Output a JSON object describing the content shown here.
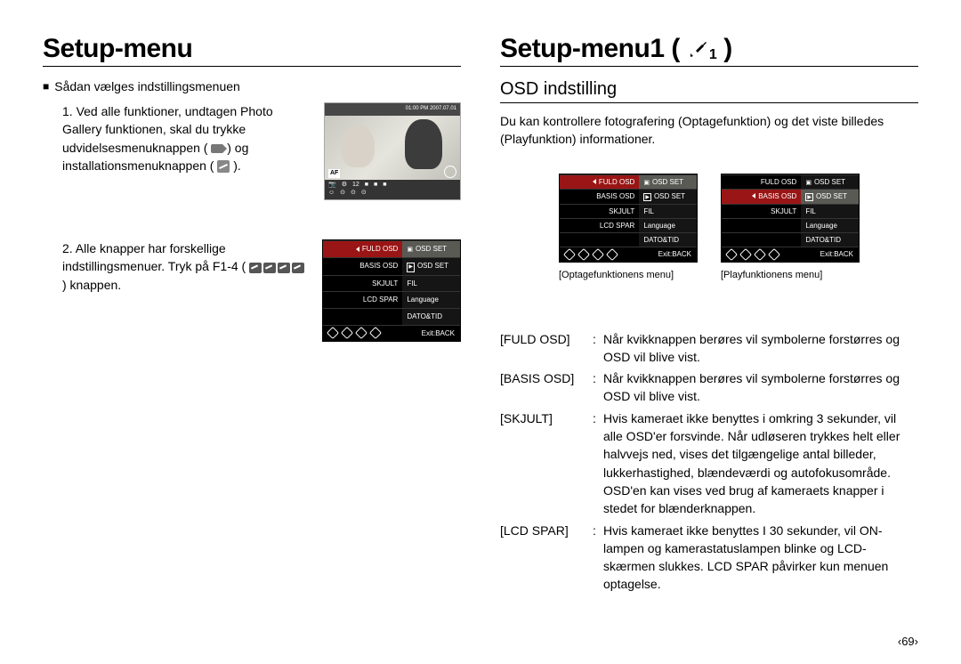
{
  "left": {
    "title": "Setup-menu",
    "section": "Sådan vælges indstillingsmenuen",
    "step1_pre": "1. Ved alle funktioner, undtagen Photo Gallery funktionen, skal du trykke udvidelsesmenuknappen (",
    "step1_mid": ") og installationsmenuknappen (",
    "step1_post": ").",
    "step2_pre": "2. Alle knapper har forskellige indstillingsmenuer. Tryk på F1-4 (",
    "step2_post": ") knappen.",
    "photo": {
      "top": "01:00 PM 2007.07.01",
      "af": "AF",
      "count": "12"
    }
  },
  "right": {
    "title": "Setup-menu1 (",
    "title_end": ")",
    "sub": "OSD indstilling",
    "desc": "Du kan kontrollere fotografering (Optagefunktion) og det viste billedes (Playfunktion) informationer.",
    "caption_left": "[Optagefunktionens menu]",
    "caption_right": "[Playfunktionens menu]"
  },
  "menu_full": {
    "rows": [
      {
        "l": "FULD OSD",
        "r": "OSD SET",
        "ricon": "cam"
      },
      {
        "l": "BASIS OSD",
        "r": "OSD SET",
        "ricon": "play"
      },
      {
        "l": "SKJULT",
        "r": "FIL"
      },
      {
        "l": "LCD SPAR",
        "r": "Language"
      },
      {
        "l": "",
        "r": "DATO&TID"
      }
    ],
    "exit": "Exit:BACK"
  },
  "menu_short": {
    "rows": [
      {
        "l": "FULD OSD",
        "r": "OSD SET",
        "ricon": "cam"
      },
      {
        "l": "BASIS OSD",
        "r": "OSD SET",
        "ricon": "play"
      },
      {
        "l": "SKJULT",
        "r": "FIL"
      },
      {
        "l": "",
        "r": "Language"
      },
      {
        "l": "",
        "r": "DATO&TID"
      }
    ],
    "exit": "Exit:BACK"
  },
  "defs": [
    {
      "k": "[FULD OSD]",
      "v": "Når kvikknappen berøres vil symbolerne forstørres og OSD vil blive vist."
    },
    {
      "k": "[BASIS OSD]",
      "v": "Når kvikknappen berøres vil symbolerne forstørres og OSD vil blive vist."
    },
    {
      "k": "[SKJULT]",
      "v": "Hvis kameraet ikke benyttes i omkring 3 sekunder, vil alle OSD'er forsvinde. Når udløseren trykkes helt eller halvvejs ned, vises det tilgængelige antal billeder, lukkerhastighed, blændeværdi og autofokusområde. OSD'en kan vises ved brug af kameraets knapper i stedet for blænderknappen."
    },
    {
      "k": "[LCD SPAR]",
      "v": "Hvis kameraet ikke benyttes I 30 sekunder, vil ON-lampen og kamerastatuslampen blinke og LCD-skærmen slukkes. LCD SPAR påvirker kun menuen optagelse."
    }
  ],
  "page": "69"
}
